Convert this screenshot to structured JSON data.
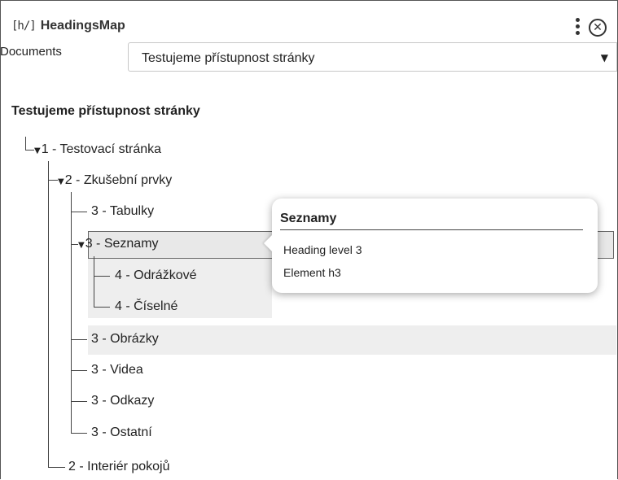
{
  "header": {
    "logo_mark": "[h/]",
    "title": "HeadingsMap",
    "menu_icon": "kebab-menu-icon",
    "close_icon": "close-circle-icon"
  },
  "documents": {
    "label": "Documents",
    "selected": "Testujeme přístupnost stránky",
    "arrow": "▼"
  },
  "tree": {
    "root_title": "Testujeme přístupnost stránky",
    "toggle_glyph": "▼",
    "items": [
      {
        "label": "1 - Testovací stránka"
      },
      {
        "label": "2 - Zkušební prvky"
      },
      {
        "label": "3 - Tabulky"
      },
      {
        "label": "3 - Seznamy"
      },
      {
        "label": "4 - Odrážkové"
      },
      {
        "label": "4 - Číselné"
      },
      {
        "label": "3 - Obrázky"
      },
      {
        "label": "3 - Videa"
      },
      {
        "label": "3 - Odkazy"
      },
      {
        "label": "3 - Ostatní"
      },
      {
        "label": "2 - Interiér pokojů"
      }
    ]
  },
  "tooltip": {
    "title": "Seznamy",
    "line1": "Heading level 3",
    "line2": "Element h3"
  },
  "colors": {
    "highlight": "#eeeeee",
    "tree_line": "#444444",
    "border": "#555555"
  }
}
